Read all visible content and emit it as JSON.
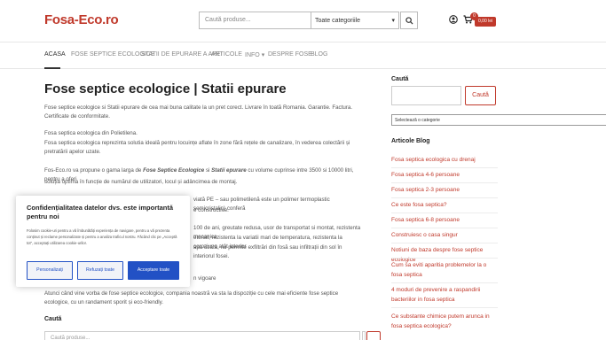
{
  "header": {
    "logo": "Fosa-Eco.ro",
    "search_placeholder": "Caută produse...",
    "category_selected": "Toate categoriile",
    "cart_count": "0",
    "cart_total": "0,00 lei"
  },
  "nav": {
    "items": [
      "ACASA",
      "FOSE SEPTICE ECOLOGICE",
      "STATII DE EPURARE A APEI",
      "ARTICOLE",
      "INFO",
      "DESPRE FOSE",
      "BLOG"
    ]
  },
  "main": {
    "title": "Fose septice ecologice | Statii epurare",
    "p1": "Fose septice ecologice si Statii epurare de cea mai buna calitate la un pret corect. Livrare în toată Romania. Garantie. Factura. Certificate de conformitate.",
    "p2a": "Fosa septica ecologica din Polietilena.",
    "p2b": "Fosa septica ecologica reprezinta solutia ideală pentru locuințe aflate în zone fără rețele de canalizare, în vederea colectării și pretratării apelor uzate.",
    "p3_start": "Fos-Eco.ro va propune o gama larga de ",
    "p3_b1": "Fose Septice Ecologice",
    "p3_mid": " si ",
    "p3_b2": "Statii epurare",
    "p3_end": " cu volume cuprinse intre 3500 si 10000 litri, pentru a oferi",
    "p3_line2": "soluția optima în funcție de numărul de utilizatori, locul și adâncimea de montaj.",
    "p4_line1": "viată PE – sau polimetilenă este un polimer termoplastic semicristalin) conferă",
    "p4_line2": "e constructive.",
    "p5_line1": "100 de ani, greutate redusa, usor de transportat si montat, rezistenta mecanica",
    "p5_line2": "etonat, rezistenta la variatii mari de temperatura, rezistenta la coroziune atât interior",
    "p5_line3": "apa uzată, nu permite exfiltrări din fosă sau infiltrații din sol în interiorul fosei.",
    "p6_tail": "n vigoare",
    "p7": "Atunci când vine vorba de fose septice ecologice, compania noastră va sta la dispoziție cu cele mai eficiente fose septice ecologice, cu un randament sporit și eco-friendly.",
    "search_label": "Caută",
    "search_placeholder": "Caută produse..."
  },
  "sidebar": {
    "search_heading": "Caută",
    "search_button": "Caută",
    "category_select": "Selectează o categorie",
    "blog_heading": "Articole Blog",
    "blog_links": [
      "Fosa septica ecologica cu drenaj",
      "Fosa septica 4-6 persoane",
      "Fosa septica 2-3 persoane",
      "Ce este fosa septica?",
      "Fosa septica 6-8 persoane",
      "Construiesc o casa singur",
      "Notiuni de baza despre fose septice ecologice",
      "Cum sa eviti aparitia problemelor la o fosa septica",
      "4 moduri de prevenire a raspandirii bacteriilor in fosa septica",
      "Ce substante chimice putem arunca in fosa septica ecologica?"
    ]
  },
  "cookie": {
    "title": "Confidențialitatea datelor dvs. este importantă pentru noi",
    "text": "Folosim cookie-uri pentru a vă îmbunătăți experiența de navigare, pentru a vă prezenta conținut și reclame personalizate și pentru a analiza traficul nostru. Făcând clic pe „Acceptă tot”, acceptați utilizarea cookie-urilor.",
    "btn_customize": "Personalizați",
    "btn_reject": "Refuzați toate",
    "btn_accept": "Acceptare toate"
  },
  "colors": {
    "accent": "#c0392b",
    "cookie_blue": "#2251c5"
  },
  "icons": [
    "search-icon",
    "user-icon",
    "cart-icon",
    "chevron-down-icon"
  ]
}
